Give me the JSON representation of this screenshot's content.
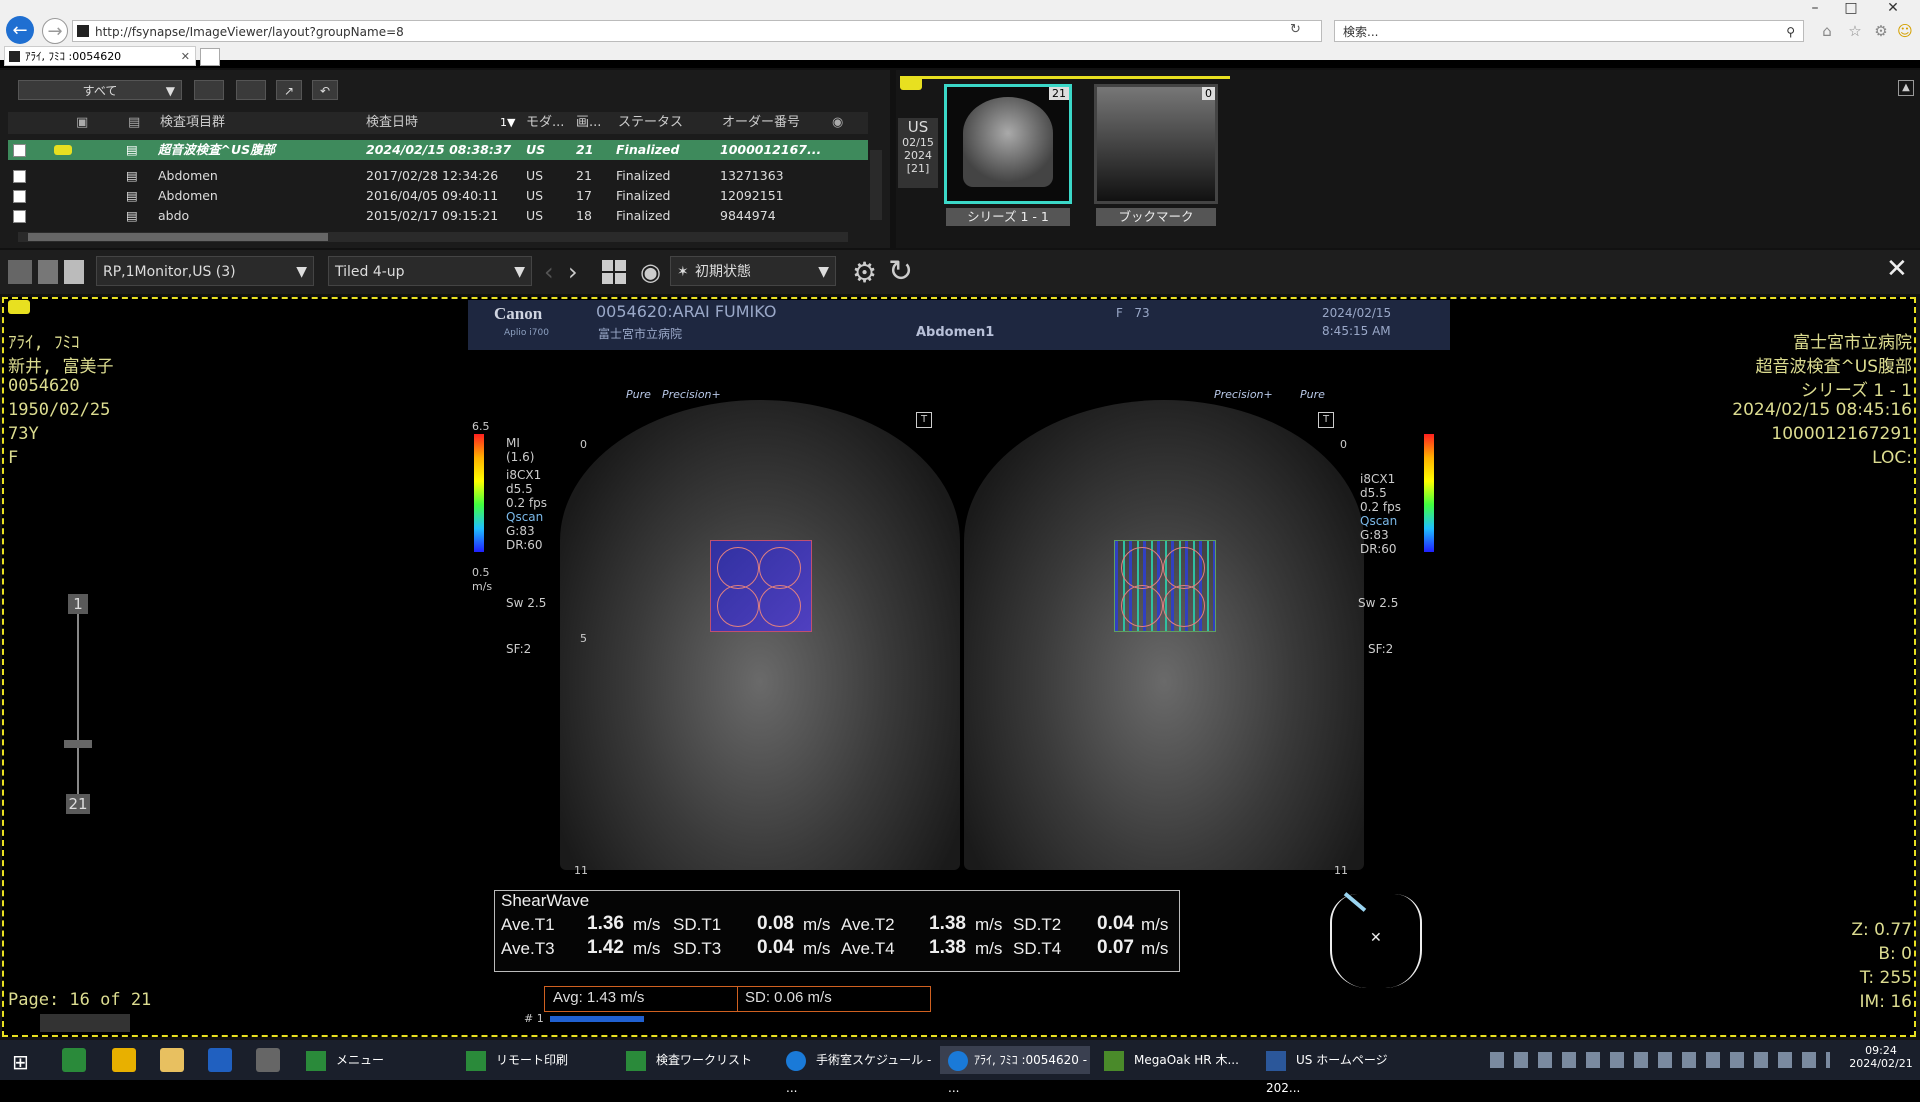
{
  "browser": {
    "url": "http://fsynapse/ImageViewer/layout?groupName=8",
    "search_placeholder": "検索...",
    "tab_title": "ｱﾗｲ, ﾌﾐｺ :0054620"
  },
  "study_list": {
    "filter": "すべて",
    "columns": [
      "検査項目群",
      "検査日時",
      "モダ...",
      "画...",
      "ステータス",
      "オーダー番号"
    ],
    "sort_indicator": "1▼",
    "rows": [
      {
        "name": "超音波検査^US腹部",
        "date": "2024/02/15 08:38:37",
        "modality": "US",
        "images": "21",
        "status": "Finalized",
        "order": "1000012167..."
      },
      {
        "name": "Abdomen",
        "date": "2017/02/28 12:34:26",
        "modality": "US",
        "images": "21",
        "status": "Finalized",
        "order": "13271363"
      },
      {
        "name": "Abdomen",
        "date": "2016/04/05 09:40:11",
        "modality": "US",
        "images": "17",
        "status": "Finalized",
        "order": "12092151"
      },
      {
        "name": "abdo",
        "date": "2015/02/17 09:15:21",
        "modality": "US",
        "images": "18",
        "status": "Finalized",
        "order": "9844974"
      }
    ]
  },
  "thumbnails": {
    "study_modality": "US",
    "study_date_md": "02/15",
    "study_year": "2024",
    "study_count": "[21]",
    "series": [
      {
        "label": "シリーズ 1 - 1",
        "count": "21"
      },
      {
        "label": "ブックマーク",
        "count": "0"
      }
    ]
  },
  "toolbar": {
    "monitor": "RP,1Monitor,US (3)",
    "layout": "Tiled 4-up",
    "preset": "初期状態"
  },
  "overlay_left": {
    "kana": "ｱﾗｲ, ﾌﾐｺ",
    "kanji": "新井, 富美子",
    "patient_id": "0054620",
    "dob": "1950/02/25",
    "age": "73Y",
    "sex": "F",
    "page": "Page: 16 of 21",
    "slider_top": "1",
    "slider_bottom": "21"
  },
  "overlay_right": {
    "hospital": "富士宮市立病院",
    "exam": "超音波検査^US腹部",
    "series": "シリーズ 1 - 1",
    "datetime": "2024/02/15 08:45:16",
    "accession": "1000012167291",
    "loc": "LOC:",
    "z": "Z: 0.77",
    "b": "B: 0",
    "t": "T: 255",
    "im": "IM: 16"
  },
  "us_header": {
    "brand": "Canon",
    "model": "Aplio i700",
    "patient": "0054620:ARAI FUMIKO",
    "hospital": "富士宮市立病院",
    "sex_age": "F   73",
    "date": "2024/02/15",
    "time": "8:45:15 AM",
    "preset": "Abdomen1"
  },
  "us_params": {
    "scale_top": "6.5",
    "scale_bottom": "0.5",
    "scale_unit": "m/s",
    "mi": "MI",
    "mi_val": "(1.6)",
    "probe": "i8CX1",
    "depth": "d5.5",
    "fps": "0.2 fps",
    "qscan": "Qscan",
    "gain": "G:83",
    "dr": "DR:60",
    "sw": "Sw 2.5",
    "sf": "SF:2",
    "pure": "Pure",
    "precision": "Precision+",
    "depth0": "0",
    "depth5": "5",
    "depth11": "11"
  },
  "shearwave": {
    "title": "ShearWave",
    "cells": [
      {
        "label": "Ave.T1",
        "value": "1.36",
        "unit": "m/s"
      },
      {
        "label": "SD.T1",
        "value": "0.08",
        "unit": "m/s"
      },
      {
        "label": "Ave.T2",
        "value": "1.38",
        "unit": "m/s"
      },
      {
        "label": "SD.T2",
        "value": "0.04",
        "unit": "m/s"
      },
      {
        "label": "Ave.T3",
        "value": "1.42",
        "unit": "m/s"
      },
      {
        "label": "SD.T3",
        "value": "0.04",
        "unit": "m/s"
      },
      {
        "label": "Ave.T4",
        "value": "1.38",
        "unit": "m/s"
      },
      {
        "label": "SD.T4",
        "value": "0.07",
        "unit": "m/s"
      }
    ],
    "avg": "Avg:  1.43 m/s",
    "sd": "SD:  0.06 m/s",
    "marker": "# 1"
  },
  "taskbar": {
    "items": [
      "メニュー",
      "リモート印刷",
      "検査ワークリスト",
      "手術室スケジュール - ...",
      "ｱﾗｲ, ﾌﾐｺ :0054620 - ...",
      "MegaOak HR  木...",
      "US  ホームページ 202..."
    ],
    "time": "09:24",
    "date": "2024/02/21"
  },
  "colors": {
    "selected_row": "#3e8a5c",
    "overlay_text": "#dcdc90",
    "viewport_border": "#e8e020",
    "ultrasound_header": "#1e2740"
  }
}
